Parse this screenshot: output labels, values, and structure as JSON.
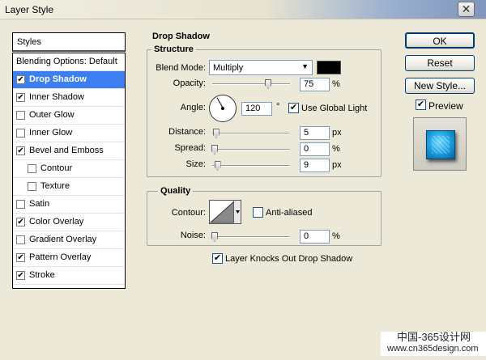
{
  "window": {
    "title": "Layer Style",
    "close_glyph": "✕"
  },
  "styles_header": "Styles",
  "styles_list": [
    {
      "label": "Blending Options: Default",
      "checkbox": false,
      "checked": false,
      "selected": false,
      "indent": 0
    },
    {
      "label": "Drop Shadow",
      "checkbox": true,
      "checked": true,
      "selected": true,
      "indent": 0
    },
    {
      "label": "Inner Shadow",
      "checkbox": true,
      "checked": true,
      "selected": false,
      "indent": 0
    },
    {
      "label": "Outer Glow",
      "checkbox": true,
      "checked": false,
      "selected": false,
      "indent": 0
    },
    {
      "label": "Inner Glow",
      "checkbox": true,
      "checked": false,
      "selected": false,
      "indent": 0
    },
    {
      "label": "Bevel and Emboss",
      "checkbox": true,
      "checked": true,
      "selected": false,
      "indent": 0
    },
    {
      "label": "Contour",
      "checkbox": true,
      "checked": false,
      "selected": false,
      "indent": 1
    },
    {
      "label": "Texture",
      "checkbox": true,
      "checked": false,
      "selected": false,
      "indent": 1
    },
    {
      "label": "Satin",
      "checkbox": true,
      "checked": false,
      "selected": false,
      "indent": 0
    },
    {
      "label": "Color Overlay",
      "checkbox": true,
      "checked": true,
      "selected": false,
      "indent": 0
    },
    {
      "label": "Gradient Overlay",
      "checkbox": true,
      "checked": false,
      "selected": false,
      "indent": 0
    },
    {
      "label": "Pattern Overlay",
      "checkbox": true,
      "checked": true,
      "selected": false,
      "indent": 0
    },
    {
      "label": "Stroke",
      "checkbox": true,
      "checked": true,
      "selected": false,
      "indent": 0
    }
  ],
  "drop_shadow": {
    "section_title": "Drop Shadow",
    "structure": {
      "title": "Structure",
      "blend_mode_label": "Blend Mode:",
      "blend_mode_value": "Multiply",
      "shadow_color": "#000000",
      "opacity_label": "Opacity:",
      "opacity_value": "75",
      "opacity_unit": "%",
      "opacity_level": 0.75,
      "angle_label": "Angle:",
      "angle_value": "120",
      "angle_unit": "°",
      "use_global_light_label": "Use Global Light",
      "use_global_light_checked": true,
      "distance_label": "Distance:",
      "distance_value": "5",
      "distance_unit": "px",
      "distance_level": 0.02,
      "spread_label": "Spread:",
      "spread_value": "0",
      "spread_unit": "%",
      "spread_level": 0.0,
      "size_label": "Size:",
      "size_value": "9",
      "size_unit": "px",
      "size_level": 0.04
    },
    "quality": {
      "title": "Quality",
      "contour_label": "Contour:",
      "anti_aliased_label": "Anti-aliased",
      "anti_aliased_checked": false,
      "noise_label": "Noise:",
      "noise_value": "0",
      "noise_unit": "%",
      "noise_level": 0.0
    },
    "knocks_out_label": "Layer Knocks Out Drop Shadow",
    "knocks_out_checked": true
  },
  "buttons": {
    "ok": "OK",
    "reset": "Reset",
    "new_style": "New Style..."
  },
  "preview": {
    "label": "Preview",
    "checked": true
  },
  "watermark": {
    "line1": "中国-365设计网",
    "line2": "www.cn365design.com"
  },
  "check_glyph": "✔"
}
